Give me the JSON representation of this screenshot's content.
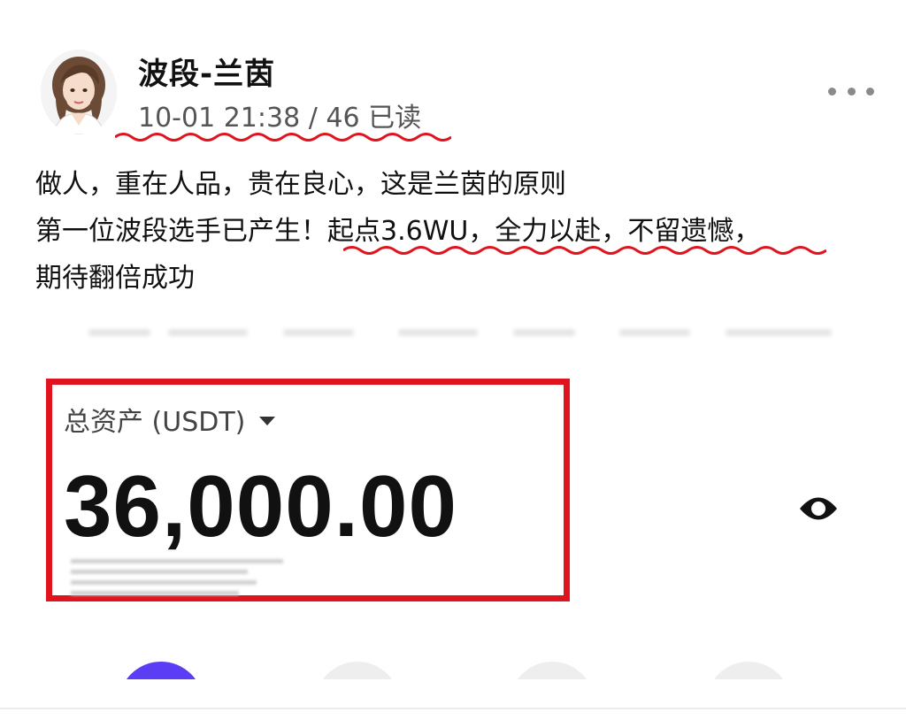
{
  "author": {
    "name": "波段-兰茵",
    "timestamp": "10-01 21:38",
    "separator": "/",
    "read_count": "46 已读"
  },
  "post": {
    "lines": [
      "做人，重在人品，贵在良心，这是兰茵的原则",
      "第一位波段选手已产生！起点3.6WU，全力以赴，不留遗憾，",
      "期待翻倍成功"
    ]
  },
  "screenshot": {
    "asset_label": "总资产 (USDT)",
    "asset_value": "36,000.00"
  },
  "icons": {
    "more": "more-dots-icon",
    "dropdown": "caret-down-icon",
    "visibility": "eye-icon",
    "avatar": "avatar"
  },
  "colors": {
    "highlight": "#e0141e",
    "accent_circle": "#5b3df5"
  }
}
